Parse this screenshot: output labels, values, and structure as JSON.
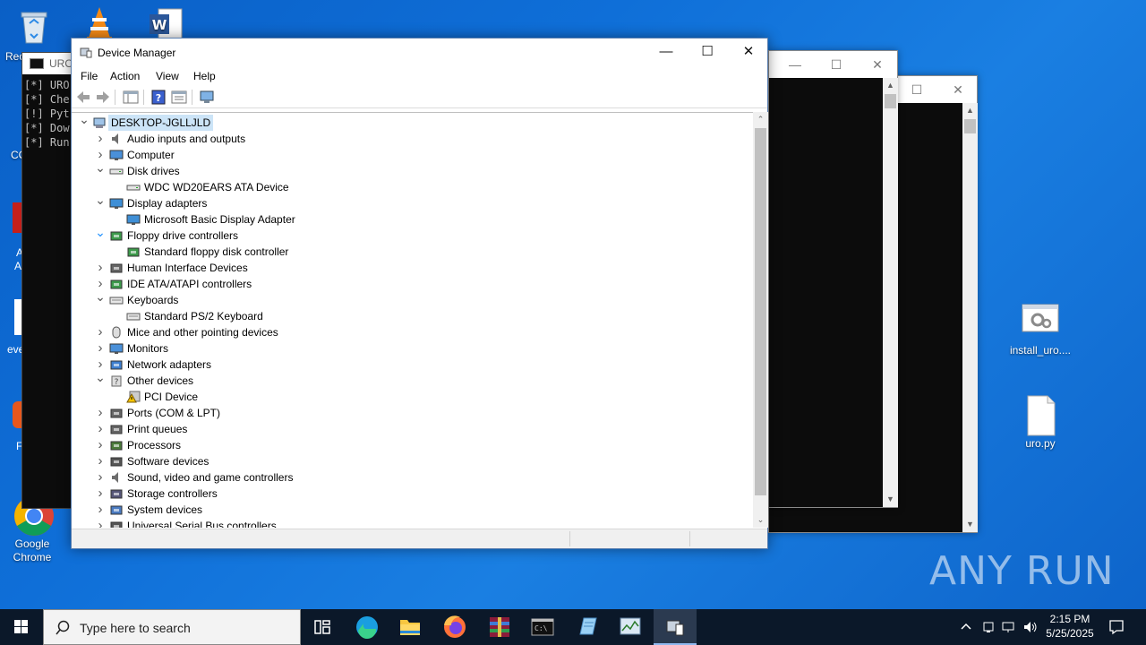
{
  "desktop": {
    "icons": [
      {
        "label": "Rec",
        "name": "recycle-bin"
      },
      {
        "label": "Google Chrome",
        "name": "google-chrome"
      },
      {
        "label": "install_uro....",
        "name": "install-uro"
      },
      {
        "label": "uro.py",
        "name": "uro-py"
      }
    ],
    "partial_labels": [
      "CC",
      "A",
      "A",
      "eve",
      "F"
    ]
  },
  "cmd": {
    "title": "URO",
    "lines": [
      "[*] URO",
      "[*] Che",
      "[!] Pyt",
      "[*] Dow",
      "[*] Run"
    ]
  },
  "device_manager": {
    "title": "Device Manager",
    "menu": [
      "File",
      "Action",
      "View",
      "Help"
    ],
    "tree": [
      {
        "label": "DESKTOP-JGLLJLD",
        "level": 0,
        "state": "expanded",
        "icon": "computer-icon",
        "root": true
      },
      {
        "label": "Audio inputs and outputs",
        "level": 1,
        "state": "collapsed",
        "icon": "speaker-icon"
      },
      {
        "label": "Computer",
        "level": 1,
        "state": "collapsed",
        "icon": "monitor-icon"
      },
      {
        "label": "Disk drives",
        "level": 1,
        "state": "expanded",
        "icon": "disk-icon"
      },
      {
        "label": "WDC WD20EARS ATA Device",
        "level": 2,
        "state": "leaf",
        "icon": "disk-icon"
      },
      {
        "label": "Display adapters",
        "level": 1,
        "state": "expanded",
        "icon": "display-adapter-icon"
      },
      {
        "label": "Microsoft Basic Display Adapter",
        "level": 2,
        "state": "leaf",
        "icon": "display-adapter-icon"
      },
      {
        "label": "Floppy drive controllers",
        "level": 1,
        "state": "expanded-hover",
        "icon": "controller-icon"
      },
      {
        "label": "Standard floppy disk controller",
        "level": 2,
        "state": "leaf",
        "icon": "controller-icon"
      },
      {
        "label": "Human Interface Devices",
        "level": 1,
        "state": "collapsed",
        "icon": "hid-icon"
      },
      {
        "label": "IDE ATA/ATAPI controllers",
        "level": 1,
        "state": "collapsed",
        "icon": "controller-icon"
      },
      {
        "label": "Keyboards",
        "level": 1,
        "state": "expanded",
        "icon": "keyboard-icon"
      },
      {
        "label": "Standard PS/2 Keyboard",
        "level": 2,
        "state": "leaf",
        "icon": "keyboard-icon"
      },
      {
        "label": "Mice and other pointing devices",
        "level": 1,
        "state": "collapsed",
        "icon": "mouse-icon"
      },
      {
        "label": "Monitors",
        "level": 1,
        "state": "collapsed",
        "icon": "monitor-icon"
      },
      {
        "label": "Network adapters",
        "level": 1,
        "state": "collapsed",
        "icon": "network-icon"
      },
      {
        "label": "Other devices",
        "level": 1,
        "state": "expanded",
        "icon": "unknown-device-icon"
      },
      {
        "label": "PCI Device",
        "level": 2,
        "state": "leaf",
        "icon": "warning-device-icon"
      },
      {
        "label": "Ports (COM & LPT)",
        "level": 1,
        "state": "collapsed",
        "icon": "port-icon"
      },
      {
        "label": "Print queues",
        "level": 1,
        "state": "collapsed",
        "icon": "printer-icon"
      },
      {
        "label": "Processors",
        "level": 1,
        "state": "collapsed",
        "icon": "processor-icon"
      },
      {
        "label": "Software devices",
        "level": 1,
        "state": "collapsed",
        "icon": "software-device-icon"
      },
      {
        "label": "Sound, video and game controllers",
        "level": 1,
        "state": "collapsed",
        "icon": "speaker-icon"
      },
      {
        "label": "Storage controllers",
        "level": 1,
        "state": "collapsed",
        "icon": "storage-icon"
      },
      {
        "label": "System devices",
        "level": 1,
        "state": "collapsed",
        "icon": "system-icon"
      },
      {
        "label": "Universal Serial Bus controllers",
        "level": 1,
        "state": "collapsed",
        "icon": "usb-icon"
      }
    ]
  },
  "watermark": "ANY RUN",
  "taskbar": {
    "search_placeholder": "Type here to search",
    "apps": [
      "task-view",
      "edge",
      "file-explorer",
      "firefox",
      "winrar",
      "terminal",
      "notepad",
      "task-manager",
      "device-manager"
    ],
    "time": "2:15 PM",
    "date": "5/25/2025"
  },
  "colors": {
    "desktop": "#0f6fd8",
    "selection": "#cce4f7",
    "taskbar": "#0b1829"
  }
}
